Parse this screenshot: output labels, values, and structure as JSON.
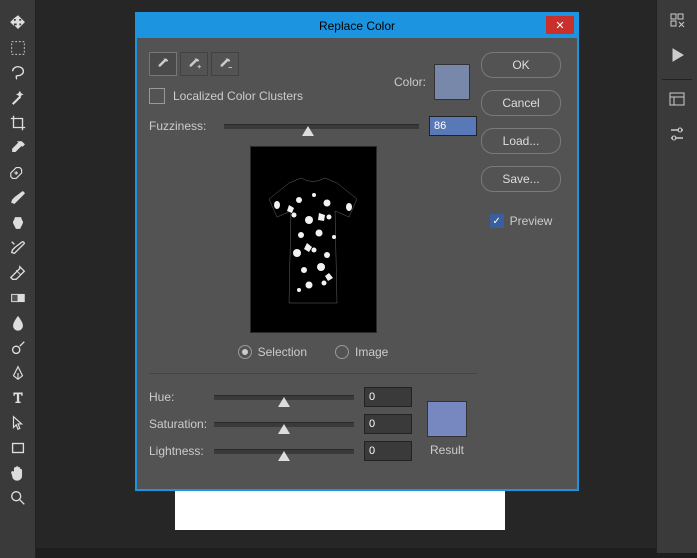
{
  "dialog": {
    "title": "Replace Color",
    "close_label": "✕",
    "buttons": {
      "ok": "OK",
      "cancel": "Cancel",
      "load": "Load...",
      "save": "Save..."
    },
    "preview_label": "Preview",
    "preview_checked": true,
    "color_label": "Color:",
    "selection_color": "#7788aa",
    "localized_label": "Localized Color Clusters",
    "localized_checked": false,
    "fuzziness_label": "Fuzziness:",
    "fuzziness_value": "86",
    "fuzziness_max": 200,
    "view_mode": {
      "selection": "Selection",
      "image": "Image",
      "selected": "selection"
    },
    "hue_label": "Hue:",
    "hue_value": "0",
    "saturation_label": "Saturation:",
    "saturation_value": "0",
    "lightness_label": "Lightness:",
    "lightness_value": "0",
    "result_label": "Result",
    "result_color": "#7788c0"
  },
  "tools": {
    "left": [
      "move",
      "marquee",
      "lasso",
      "magic-wand",
      "crop",
      "eyedropper",
      "healing",
      "brush",
      "clone",
      "eraser",
      "gradient",
      "blur",
      "dodge",
      "pen",
      "text",
      "path-select",
      "rectangle",
      "hand",
      "zoom"
    ],
    "right": [
      "collapse",
      "play",
      "panel",
      "settings"
    ]
  }
}
